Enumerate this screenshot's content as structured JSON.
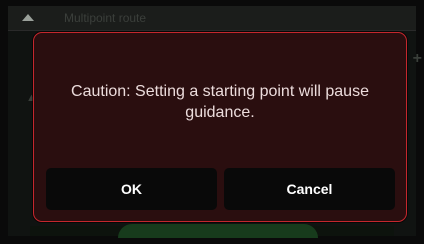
{
  "background": {
    "header_title": "Multipoint route"
  },
  "dialog": {
    "message": "Caution: Setting a starting point will pause guidance.",
    "ok_label": "OK",
    "cancel_label": "Cancel"
  },
  "colors": {
    "dialog_border": "#c5272d",
    "dialog_background": "#2a0e0f",
    "button_background": "#090909"
  }
}
